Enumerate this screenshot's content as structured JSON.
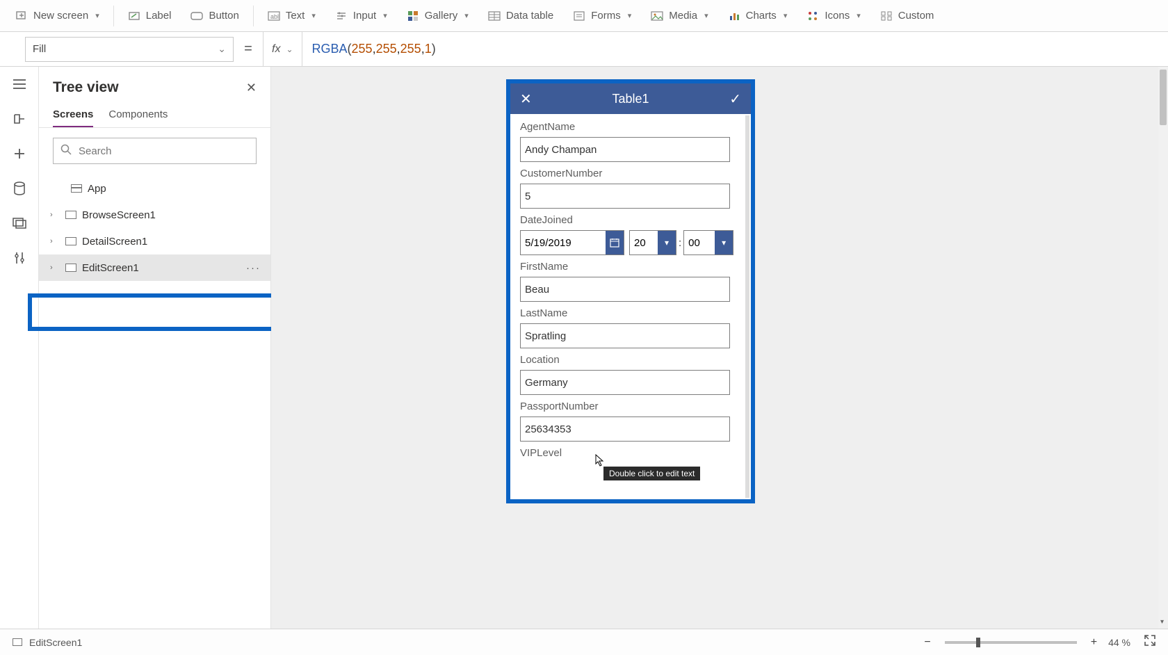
{
  "ribbon": {
    "new_screen": "New screen",
    "label": "Label",
    "button": "Button",
    "text": "Text",
    "input": "Input",
    "gallery": "Gallery",
    "data_table": "Data table",
    "forms": "Forms",
    "media": "Media",
    "charts": "Charts",
    "icons": "Icons",
    "custom": "Custom"
  },
  "formula": {
    "property": "Fill",
    "equals": "=",
    "fx": "fx",
    "fn_name": "RGBA",
    "args": [
      "255",
      "255",
      "255",
      "1"
    ]
  },
  "tree": {
    "title": "Tree view",
    "tab_screens": "Screens",
    "tab_components": "Components",
    "search_placeholder": "Search",
    "app": "App",
    "items": [
      {
        "label": "BrowseScreen1"
      },
      {
        "label": "DetailScreen1"
      },
      {
        "label": "EditScreen1"
      }
    ]
  },
  "device": {
    "title": "Table1",
    "tooltip": "Double click to edit text",
    "fields": {
      "agent_name": {
        "label": "AgentName",
        "value": "Andy Champan"
      },
      "customer_number": {
        "label": "CustomerNumber",
        "value": "5"
      },
      "date_joined": {
        "label": "DateJoined",
        "date": "5/19/2019",
        "hour": "20",
        "minute": "00"
      },
      "first_name": {
        "label": "FirstName",
        "value": "Beau"
      },
      "last_name": {
        "label": "LastName",
        "value": "Spratling"
      },
      "location": {
        "label": "Location",
        "value": "Germany"
      },
      "passport_number": {
        "label": "PassportNumber",
        "value": "25634353"
      },
      "vip_level": {
        "label": "VIPLevel",
        "value": ""
      }
    }
  },
  "status_bar": {
    "screen": "EditScreen1",
    "zoom_pct": "44",
    "pct_sign": "%"
  }
}
